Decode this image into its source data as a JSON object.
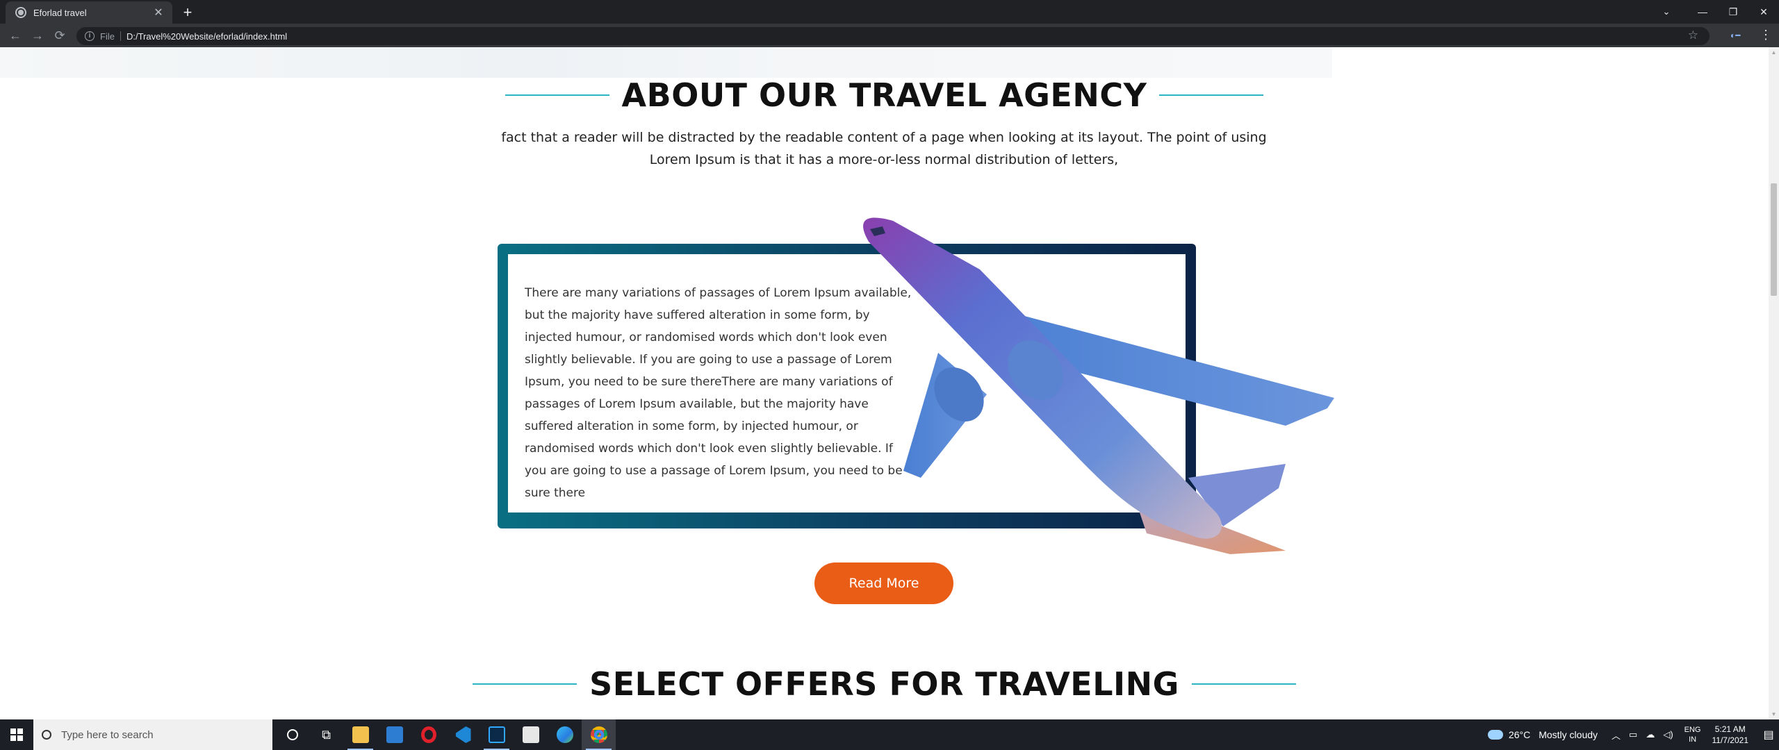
{
  "browser": {
    "tab_title": "Eforlad travel",
    "tab_close": "✕",
    "new_tab": "+",
    "scheme": "File",
    "url": "D:/Travel%20Website/eforlad/index.html",
    "back": "←",
    "forward": "→",
    "reload": "⟳",
    "star": "☆",
    "menu": "⋮",
    "window_controls": {
      "tabsearch": "⌄",
      "minimize": "—",
      "restore": "❐",
      "close": "✕"
    }
  },
  "about": {
    "title": "ABOUT OUR TRAVEL AGENCY",
    "intro": "fact that a reader will be distracted by the readable content of a page when looking at its layout. The point of using Lorem Ipsum is that it has a more-or-less normal distribution of letters,",
    "card_text": "There are many variations of passages of Lorem Ipsum available, but the majority have suffered alteration in some form, by injected humour, or randomised words which don't look even slightly believable. If you are going to use a passage of Lorem Ipsum, you need to be sure thereThere are many variations of passages of Lorem Ipsum available, but the majority have suffered alteration in some form, by injected humour, or randomised words which don't look even slightly believable. If you are going to use a passage of Lorem Ipsum, you need to be sure there",
    "button": "Read More"
  },
  "offers": {
    "title": "SELECT OFFERS FOR TRAVELING"
  },
  "taskbar": {
    "search_placeholder": "Type here to search",
    "weather_temp": "26°C",
    "weather_text": "Mostly cloudy",
    "lang_top": "ENG",
    "lang_bottom": "IN",
    "time": "5:21 AM",
    "date": "11/7/2021"
  },
  "colors": {
    "accent_orange": "#ea5d17",
    "heading_line": "#2bb5c4",
    "frame_start": "#0a6f83",
    "frame_end": "#0b2346"
  }
}
